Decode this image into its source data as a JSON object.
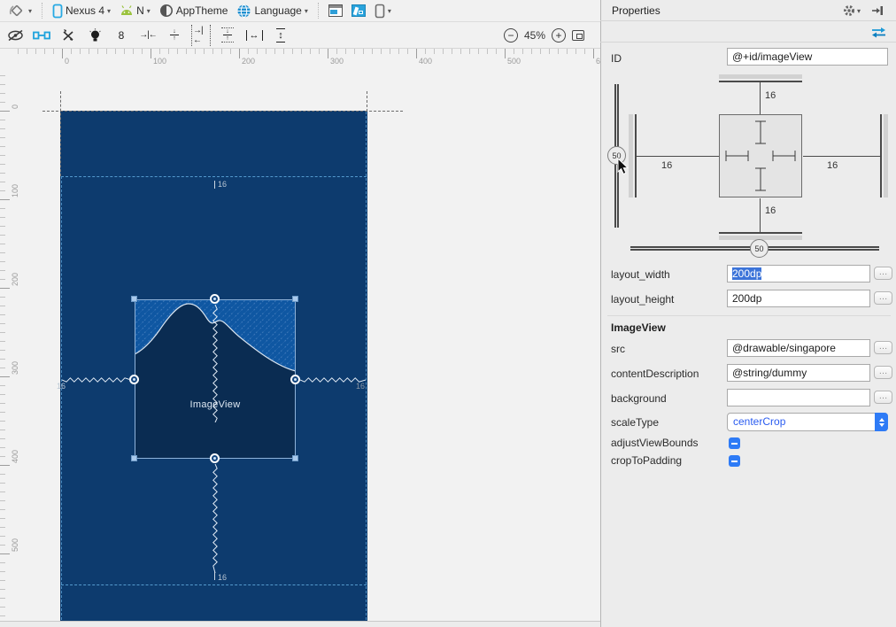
{
  "toolbar": {
    "device": "Nexus 4",
    "api": "N",
    "theme": "AppTheme",
    "language": "Language",
    "default_margin": "8",
    "zoom_level": "45%"
  },
  "rulers": {
    "h": [
      "0",
      "100",
      "200",
      "300",
      "400",
      "500",
      "6"
    ],
    "v": [
      "0",
      "100",
      "200",
      "300",
      "400",
      "500"
    ]
  },
  "canvas": {
    "widget_label": "ImageView",
    "margin_top": "16",
    "margin_bottom": "16",
    "margin_left": "16",
    "margin_right": "16"
  },
  "properties": {
    "title": "Properties",
    "id_label": "ID",
    "id_value": "@+id/imageView",
    "widget": {
      "margin_top": "16",
      "margin_left": "16",
      "margin_right": "16",
      "margin_bottom": "16",
      "vertical_bias": "50",
      "horizontal_bias": "50"
    },
    "rows": {
      "layout_width": {
        "label": "layout_width",
        "value": "200dp"
      },
      "layout_height": {
        "label": "layout_height",
        "value": "200dp"
      },
      "src": {
        "label": "src",
        "value": "@drawable/singapore"
      },
      "content_description": {
        "label": "contentDescription",
        "value": "@string/dummy"
      },
      "background": {
        "label": "background",
        "value": ""
      },
      "scale_type": {
        "label": "scaleType",
        "value": "centerCrop"
      },
      "adjust_view_bounds": {
        "label": "adjustViewBounds"
      },
      "crop_to_padding": {
        "label": "cropToPadding"
      }
    },
    "section_title": "ImageView",
    "more_button": "…"
  },
  "colors": {
    "blueprint_bg": "#0d3b6e",
    "image_fill": "#0a2c52",
    "sky_fill": "#0f57a2",
    "hatch_stripe": "#3a76b8",
    "margin_guide": "#549ace",
    "accent_blue": "#2e7bf6",
    "blueprint_mode_blue": "#29a3dc",
    "android_green": "#9ac23c"
  },
  "icons": {
    "orientation-icon": "rotated square with arc",
    "phone-device-icon": "blue phone outline",
    "android-api-icon": "green android head",
    "theme-icon": "half filled circle",
    "language-icon": "blue globe",
    "design-mode-icon": "layout square",
    "blueprint-mode-icon": "blue ruler square",
    "variant-phone-icon": "phone outline",
    "hide-constraints-icon": "eye with slash",
    "autoconnect-icon": "blue link",
    "clear-constraints-icon": "x with arrows",
    "infer-constraints-icon": "lightbulb",
    "pack-horizontal-icon": "arrows to bar",
    "pack-vertical-icon": "arrows to bar vertical",
    "center-horizontal-icon": "dotted arrows to bar",
    "center-vertical-icon": "dotted arrows to bar vertical",
    "expand-horizontal-icon": "bracketed horizontal arrow",
    "expand-vertical-icon": "bracketed vertical arrow",
    "zoom-out-icon": "circled minus",
    "zoom-in-icon": "circled plus",
    "zoom-fit-icon": "fit rectangle",
    "gear-icon": "settings gear",
    "hide-panel-icon": "arrow to bar",
    "swap-arrows-icon": "blue bidirectional arrows",
    "cursor-icon": "mouse pointer"
  }
}
